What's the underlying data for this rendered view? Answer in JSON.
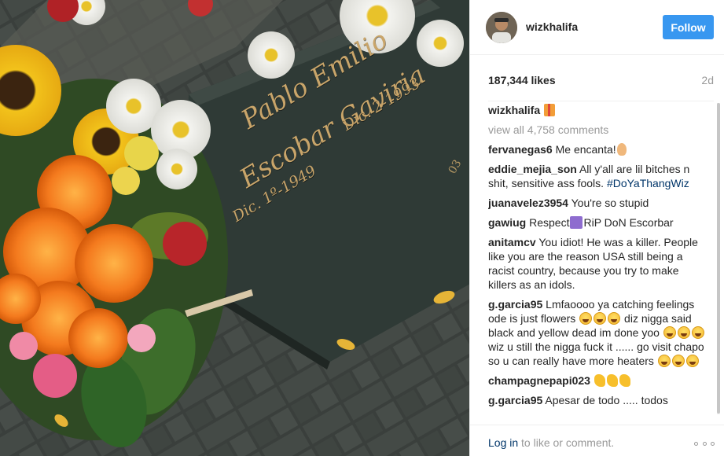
{
  "post": {
    "author": "wizkhalifa",
    "follow_label": "Follow",
    "likes": "187,344 likes",
    "age": "2d",
    "caption_user": "wizkhalifa",
    "view_all": "view all 4,758 comments",
    "footer_login": "Log in",
    "footer_text": " to like or comment."
  },
  "photo": {
    "description_icon": "grave-photo",
    "engraving": {
      "first_name": "Pablo Emilio",
      "last_name": "Escobar Gaviria",
      "born": "Dic. 1º-1949",
      "died": "Dic. 2-1993"
    }
  },
  "comments": [
    {
      "user": "fervanegas6",
      "text": " Me encanta!",
      "emoji": "hand"
    },
    {
      "user": "eddie_mejia_son",
      "text": " All y'all are lil bitches n shit, sensitive ass fools. ",
      "tag": "#DoYaThangWiz"
    },
    {
      "user": "juanavelez3954",
      "text": " You're so stupid"
    },
    {
      "user": "gawiug",
      "text_a": " Respect",
      "text_b": "RiP DoN Escorbar"
    },
    {
      "user": "anitamcv",
      "text": " You idiot! He was a killer. People like you are the reason USA still being a racist country, because you try to make killers as an idols."
    },
    {
      "user": "g.garcia95",
      "part1": " Lmfaoooo ya catching feelings ode is just flowers ",
      "part2": " diz nigga said black and yellow dead im done yoo ",
      "part3": " wiz u still the nigga fuck it ...... go visit chapo so u can really have more heaters "
    },
    {
      "user": "champagnepapi023",
      "emoji": "flex"
    },
    {
      "user": "g.garcia95",
      "text": " Apesar de todo ..... todos"
    }
  ],
  "colors": {
    "accent": "#3897f0",
    "link": "#003569",
    "muted": "#999999",
    "engraving": "#c9a56a"
  },
  "icons": {
    "more": "more-options-icon",
    "caption_emoji": "gift-icon"
  }
}
